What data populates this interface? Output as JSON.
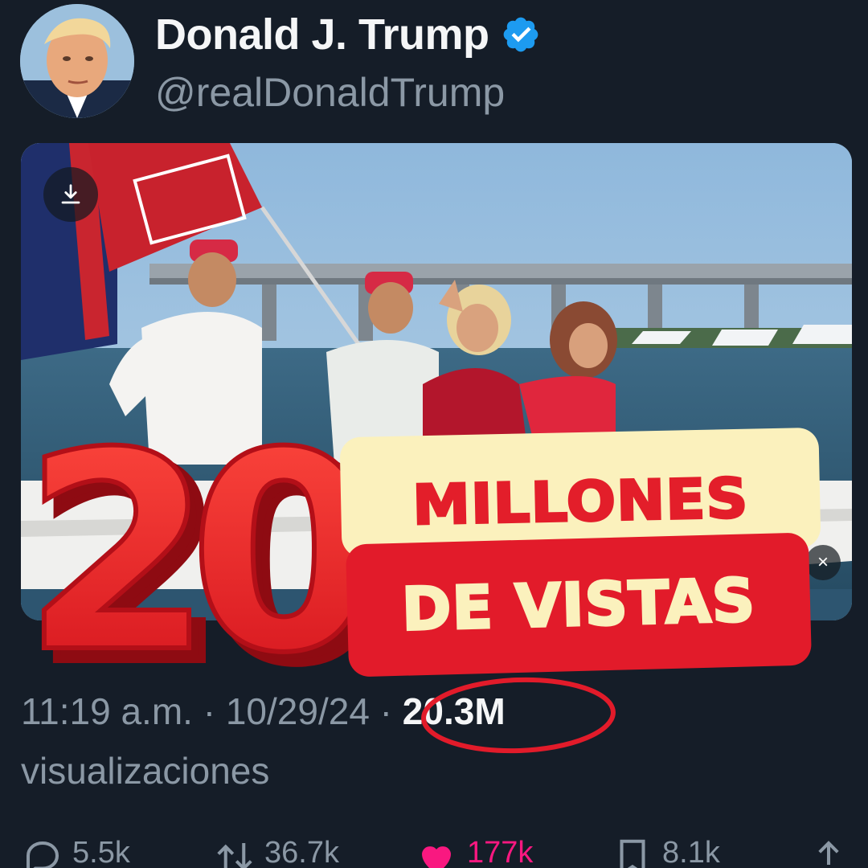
{
  "header": {
    "display_name": "Donald J. Trump",
    "handle": "@realDonaldTrump",
    "verified_icon": "verified-badge-icon"
  },
  "media": {
    "download_icon": "download-icon",
    "close_label": "×"
  },
  "overlay": {
    "big_number": "20",
    "line1": "MILLONES",
    "line2": "DE VISTAS",
    "colors": {
      "red": "#e31e2a",
      "cream": "#fbf1bd"
    }
  },
  "meta": {
    "time": "11:19 a.m.",
    "separator": " · ",
    "date": "10/29/24",
    "separator2": " · ",
    "views": "20.3M",
    "views_label": "visualizaciones"
  },
  "actions": {
    "replies": "5.5k",
    "reposts": "36.7k",
    "likes": "177k",
    "bookmarks": "8.1k"
  },
  "colors": {
    "background": "#151d28",
    "muted": "#8b98a5",
    "like": "#f91880",
    "verified": "#1d9bf0"
  }
}
